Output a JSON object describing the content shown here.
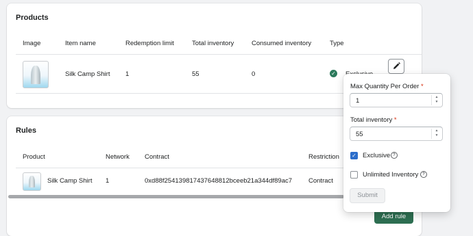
{
  "products": {
    "title": "Products",
    "columns": [
      "Image",
      "Item name",
      "Redemption limit",
      "Total inventory",
      "Consumed inventory",
      "Type"
    ],
    "rows": [
      {
        "item_name": "Silk Camp Shirt",
        "redemption_limit": "1",
        "total_inventory": "55",
        "consumed_inventory": "0",
        "type": "Exclusive"
      }
    ]
  },
  "rules": {
    "title": "Rules",
    "columns": [
      "Product",
      "Network",
      "Contract",
      "Restriction"
    ],
    "rows": [
      {
        "product": "Silk Camp Shirt",
        "network": "1",
        "contract": "0xd88f25413981743764881 2bceeb21a344df89ac7",
        "restriction": "Contract"
      }
    ],
    "add_rule_label": "Add rule"
  },
  "edit_popover": {
    "max_qty_label": "Max Quantity Per Order",
    "max_qty_value": "1",
    "total_inventory_label": "Total inventory",
    "total_inventory_value": "55",
    "required_mark": "*",
    "exclusive_label": "Exclusive",
    "exclusive_checked": true,
    "unlimited_label": "Unlimited Inventory",
    "unlimited_checked": false,
    "submit_label": "Submit"
  },
  "colors": {
    "primary_button": "#2e6f52",
    "status_success": "#2c7a5c",
    "checkbox_checked": "#2c6ecb",
    "required": "#d72c0d"
  },
  "icons": {
    "edit": "pencil-icon",
    "status": "check-circle-icon",
    "help": "question-circle-icon"
  }
}
